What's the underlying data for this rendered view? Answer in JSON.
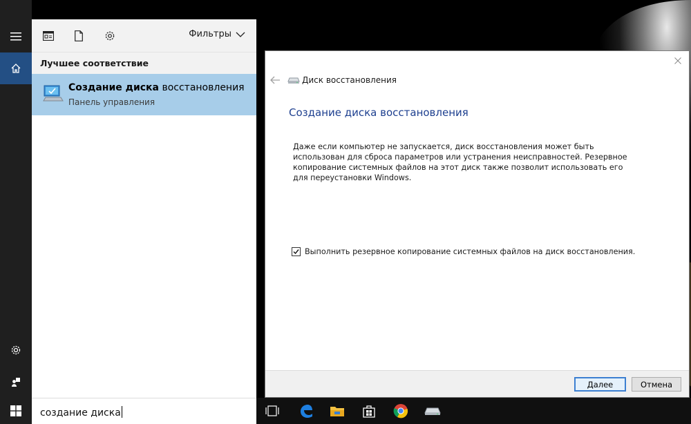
{
  "start": {
    "menu_icon": "hamburger-icon",
    "home_icon": "home-icon",
    "settings_icon": "gear-icon",
    "user_icon": "user-icon",
    "windows_icon": "windows-logo-icon"
  },
  "search_panel": {
    "toolbar": {
      "apps_icon": "apps-icon",
      "documents_icon": "document-icon",
      "settings_icon": "gear-icon",
      "filters_label": "Фильтры"
    },
    "section_title": "Лучшее соответствие",
    "best_match": {
      "title_bold": "Создание диска",
      "title_rest": " восстановления",
      "subtitle": "Панель управления"
    },
    "query": "создание диска"
  },
  "dialog": {
    "window_title": "Диск восстановления",
    "heading": "Создание диска восстановления",
    "description": "Даже если компьютер не запускается, диск восстановления может быть использован для сброса параметров или устранения неисправностей. Резервное копирование системных файлов на этот диск также позволит использовать его для переустановки Windows.",
    "checkbox_label": "Выполнить резервное копирование системных файлов на диск восстановления.",
    "checkbox_checked": true,
    "next_button": "Далее",
    "cancel_button": "Отмена"
  },
  "taskbar": {
    "icons": [
      "task-view-icon",
      "edge-icon",
      "file-explorer-icon",
      "store-icon",
      "chrome-icon",
      "recovery-drive-icon"
    ]
  },
  "colors": {
    "accent": "#234f84",
    "selection": "#a7cde9",
    "heading_blue": "#1d3f8f"
  }
}
